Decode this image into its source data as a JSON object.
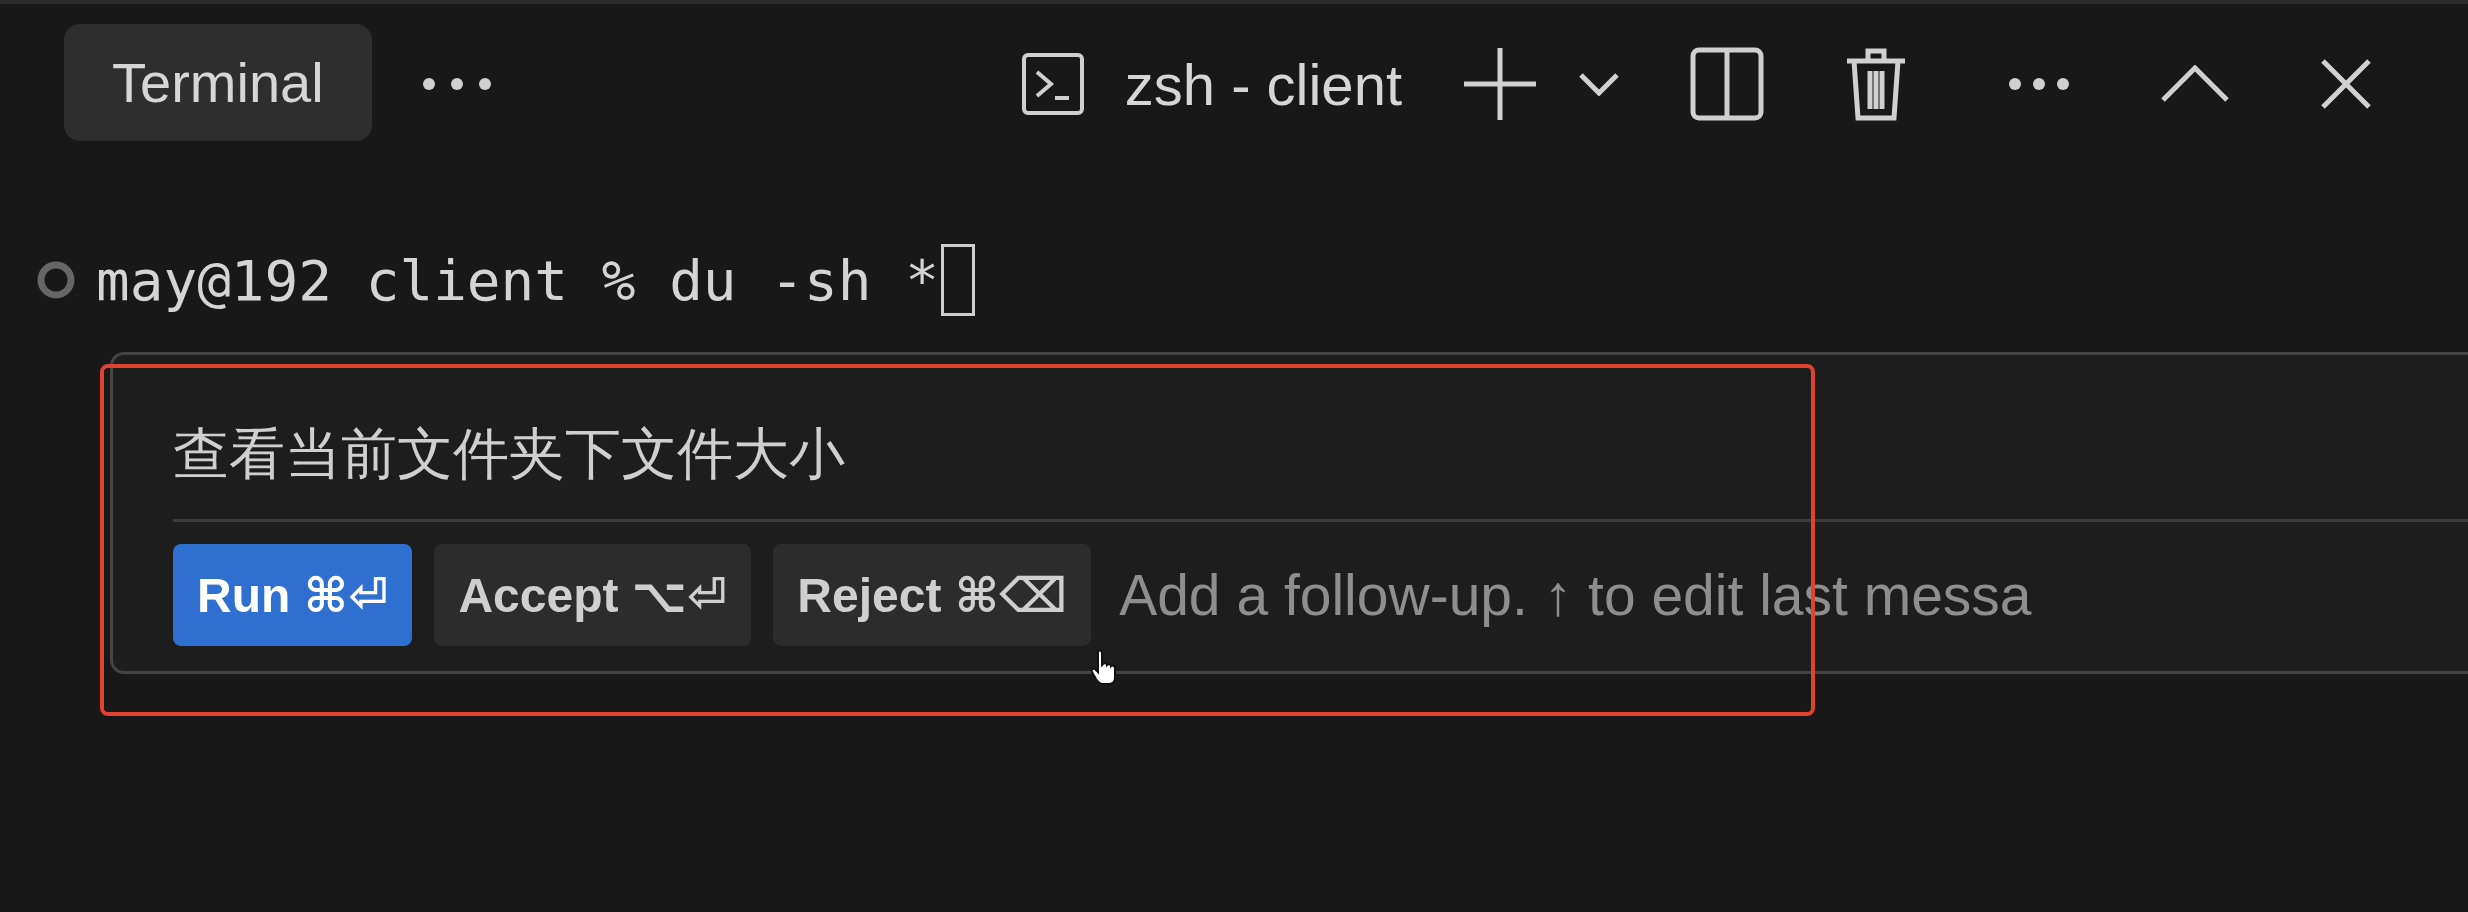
{
  "panel_tabs": [
    {
      "label": "Terminal",
      "selected": true
    }
  ],
  "terminal_selector": {
    "label": "zsh - client"
  },
  "prompt": {
    "text": "may@192 client % du -sh *"
  },
  "inline_chat": {
    "prompt": "查看当前文件夹下文件大小",
    "buttons": [
      {
        "label": "Run ⌘⏎",
        "primary": true
      },
      {
        "label": "Accept ⌥⏎",
        "primary": false
      },
      {
        "label": "Reject ⌘⌫",
        "primary": false
      }
    ],
    "followup": {
      "placeholder": "Add a follow-up. ↑ to edit last messa"
    }
  }
}
